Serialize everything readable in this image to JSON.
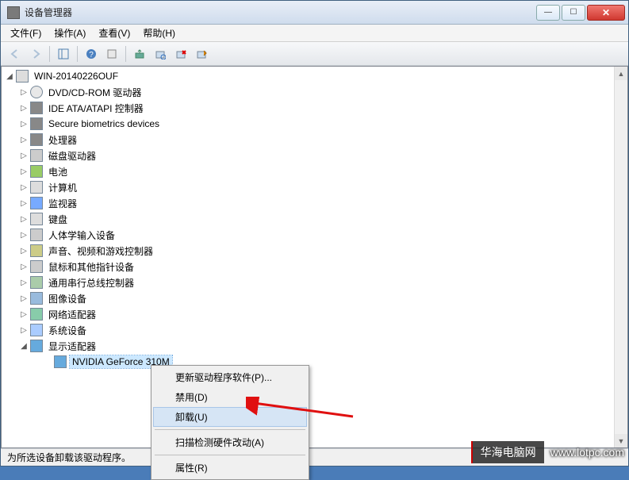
{
  "window": {
    "title": "设备管理器"
  },
  "menu": {
    "file": "文件(F)",
    "action": "操作(A)",
    "view": "查看(V)",
    "help": "帮助(H)"
  },
  "tree": {
    "root": "WIN-20140226OUF",
    "items": [
      "DVD/CD-ROM 驱动器",
      "IDE ATA/ATAPI 控制器",
      "Secure biometrics devices",
      "处理器",
      "磁盘驱动器",
      "电池",
      "计算机",
      "监视器",
      "键盘",
      "人体学输入设备",
      "声音、视频和游戏控制器",
      "鼠标和其他指针设备",
      "通用串行总线控制器",
      "图像设备",
      "网络适配器",
      "系统设备",
      "显示适配器"
    ],
    "display_child": "NVIDIA GeForce 310M"
  },
  "context": {
    "update": "更新驱动程序软件(P)...",
    "disable": "禁用(D)",
    "uninstall": "卸载(U)",
    "scan": "扫描检测硬件改动(A)",
    "properties": "属性(R)"
  },
  "status": "为所选设备卸载该驱动程序。",
  "watermark": {
    "brand": "华海电脑网",
    "url": "www.lotpc.com"
  }
}
